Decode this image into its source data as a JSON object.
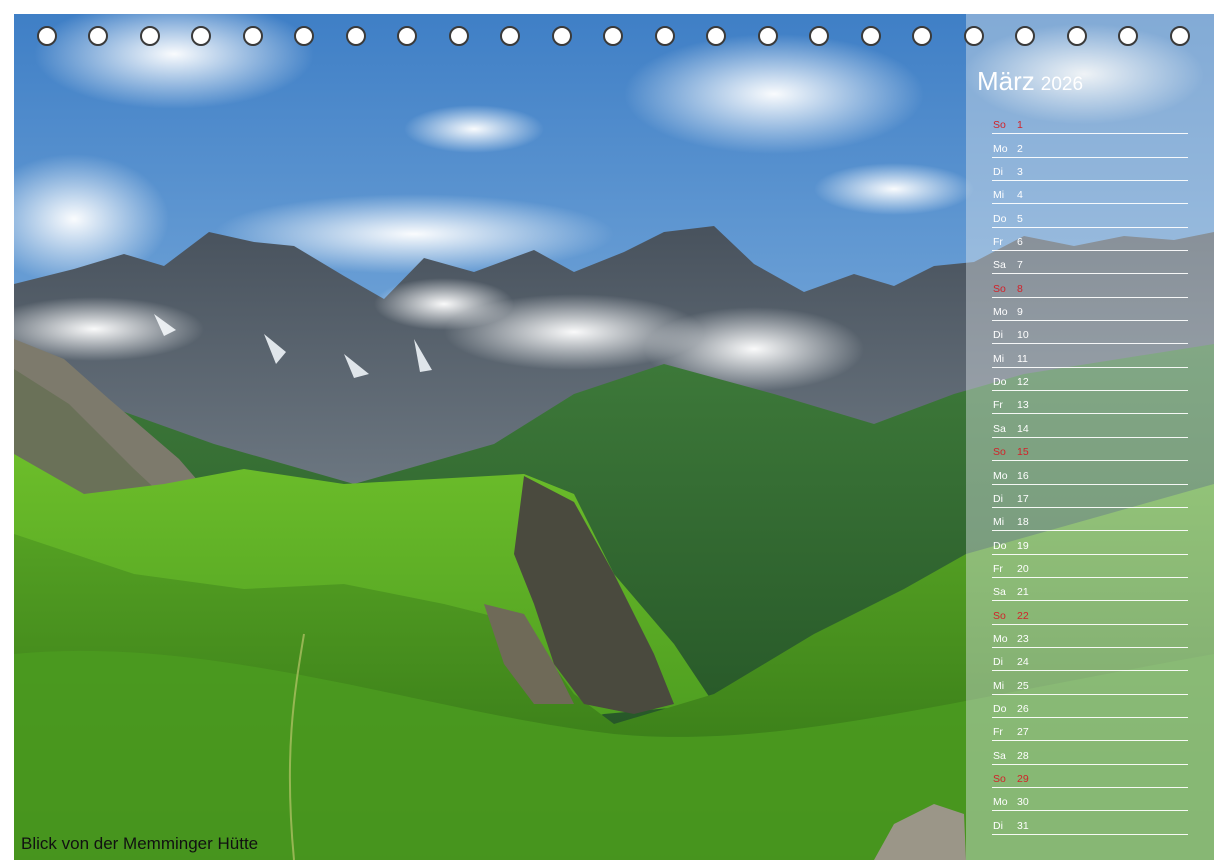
{
  "calendar": {
    "month": "März",
    "year": "2026",
    "caption": "Blick von der Memminger Hütte",
    "days": [
      {
        "wd": "So",
        "d": "1",
        "sunday": true
      },
      {
        "wd": "Mo",
        "d": "2"
      },
      {
        "wd": "Di",
        "d": "3"
      },
      {
        "wd": "Mi",
        "d": "4"
      },
      {
        "wd": "Do",
        "d": "5"
      },
      {
        "wd": "Fr",
        "d": "6"
      },
      {
        "wd": "Sa",
        "d": "7"
      },
      {
        "wd": "So",
        "d": "8",
        "sunday": true
      },
      {
        "wd": "Mo",
        "d": "9"
      },
      {
        "wd": "Di",
        "d": "10"
      },
      {
        "wd": "Mi",
        "d": "11"
      },
      {
        "wd": "Do",
        "d": "12"
      },
      {
        "wd": "Fr",
        "d": "13"
      },
      {
        "wd": "Sa",
        "d": "14"
      },
      {
        "wd": "So",
        "d": "15",
        "sunday": true
      },
      {
        "wd": "Mo",
        "d": "16"
      },
      {
        "wd": "Di",
        "d": "17"
      },
      {
        "wd": "Mi",
        "d": "18"
      },
      {
        "wd": "Do",
        "d": "19"
      },
      {
        "wd": "Fr",
        "d": "20"
      },
      {
        "wd": "Sa",
        "d": "21"
      },
      {
        "wd": "So",
        "d": "22",
        "sunday": true
      },
      {
        "wd": "Mo",
        "d": "23"
      },
      {
        "wd": "Di",
        "d": "24"
      },
      {
        "wd": "Mi",
        "d": "25"
      },
      {
        "wd": "Do",
        "d": "26"
      },
      {
        "wd": "Fr",
        "d": "27"
      },
      {
        "wd": "Sa",
        "d": "28"
      },
      {
        "wd": "So",
        "d": "29",
        "sunday": true
      },
      {
        "wd": "Mo",
        "d": "30"
      },
      {
        "wd": "Di",
        "d": "31"
      }
    ]
  },
  "colors": {
    "sunday": "#d2232a",
    "text": "#ffffff"
  }
}
